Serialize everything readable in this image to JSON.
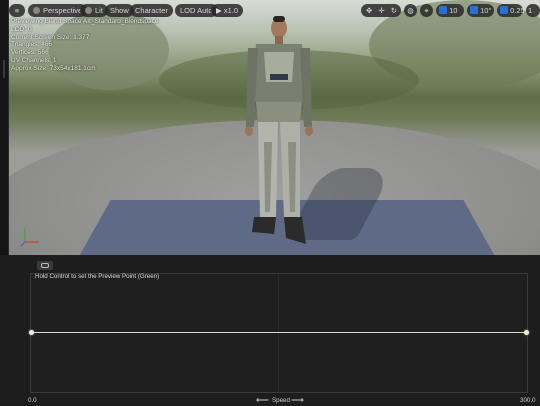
{
  "toolbar": {
    "perspective": "Perspective",
    "lit": "Lit",
    "show": "Show",
    "character": "Character",
    "lod": "LOD Auto",
    "speed": "x1.0",
    "grid_value": "10",
    "angle_value": "10°",
    "scale_value": "0.25",
    "camera_value": "1"
  },
  "info": {
    "line1": "Previewing Blend Space AIt_Standard_Blendspace",
    "line2": "LOD: 0",
    "line3": "Current Screen Size: 1.377",
    "line4": "Triangles: 466",
    "line5": "Vertices: 566",
    "line6": "UV Channels: 1",
    "line7": "Approx Size: 73x54x181.1cm"
  },
  "blendspace": {
    "hint": "Hold Control to set the Preview Point (Green)",
    "x_min": "0.0",
    "x_max": "300.0",
    "axis_label": "Speed",
    "arrow_left": "⟵",
    "arrow_right": "⟶"
  },
  "colors": {
    "accent": "#2a6fd6",
    "panel": "#1d1d1d"
  }
}
